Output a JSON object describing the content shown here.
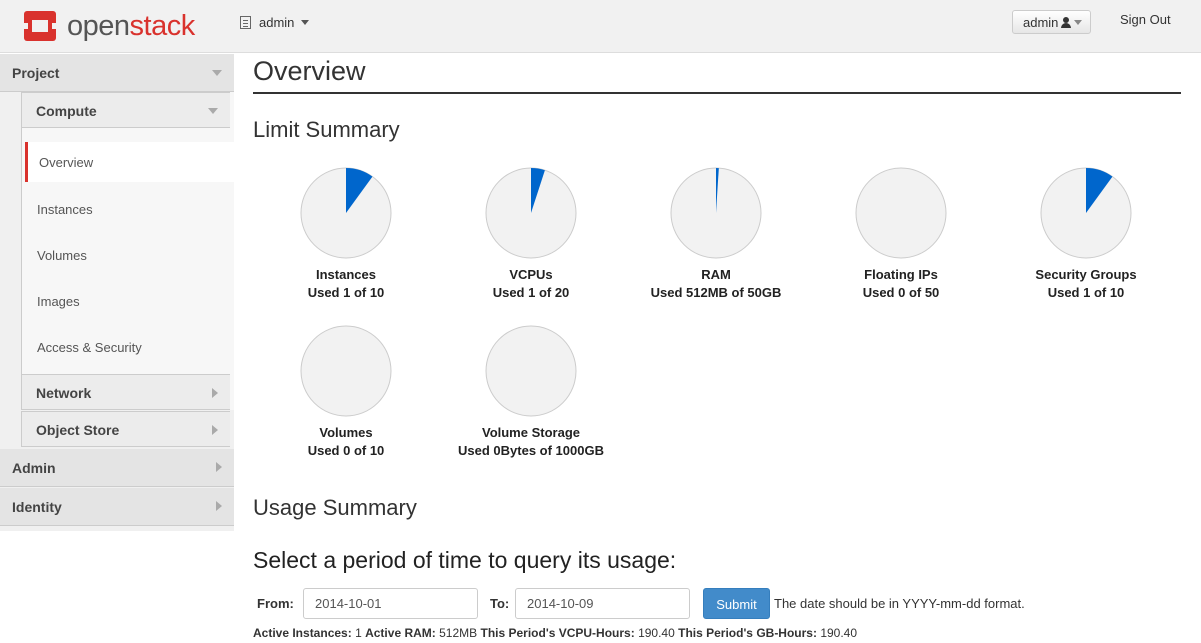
{
  "header": {
    "logo_open": "open",
    "logo_stack": "stack",
    "project": "admin",
    "user": "admin",
    "signout": "Sign Out"
  },
  "sidebar": {
    "project": "Project",
    "compute": "Compute",
    "items": [
      "Overview",
      "Instances",
      "Volumes",
      "Images",
      "Access & Security"
    ],
    "network": "Network",
    "object_store": "Object Store",
    "admin": "Admin",
    "identity": "Identity"
  },
  "main": {
    "title": "Overview",
    "limit_summary": "Limit Summary",
    "usage_summary": "Usage Summary",
    "query_heading": "Select a period of time to query its usage:",
    "from_label": "From:",
    "from_value": "2014-10-01",
    "to_label": "To:",
    "to_value": "2014-10-09",
    "submit": "Submit",
    "hint": "The date should be in YYYY-mm-dd format.",
    "summary": {
      "active_instances_label": "Active Instances:",
      "active_instances": "1",
      "active_ram_label": "Active RAM:",
      "active_ram": "512MB",
      "vcpu_hours_label": "This Period's VCPU-Hours:",
      "vcpu_hours": "190.40",
      "gb_hours_label": "This Period's GB-Hours:",
      "gb_hours": "190.40"
    }
  },
  "limits": [
    {
      "name": "Instances",
      "used_text": "Used 1 of 10",
      "fraction": 0.1
    },
    {
      "name": "VCPUs",
      "used_text": "Used 1 of 20",
      "fraction": 0.05
    },
    {
      "name": "RAM",
      "used_text": "Used 512MB of 50GB",
      "fraction": 0.01
    },
    {
      "name": "Floating IPs",
      "used_text": "Used 0 of 50",
      "fraction": 0
    },
    {
      "name": "Security Groups",
      "used_text": "Used 1 of 10",
      "fraction": 0.1
    },
    {
      "name": "Volumes",
      "used_text": "Used 0 of 10",
      "fraction": 0
    },
    {
      "name": "Volume Storage",
      "used_text": "Used 0Bytes of 1000GB",
      "fraction": 0
    }
  ],
  "colors": {
    "accent": "#d9322d",
    "pie_fill": "#0066cc",
    "pie_bg": "#f2f2f2"
  }
}
